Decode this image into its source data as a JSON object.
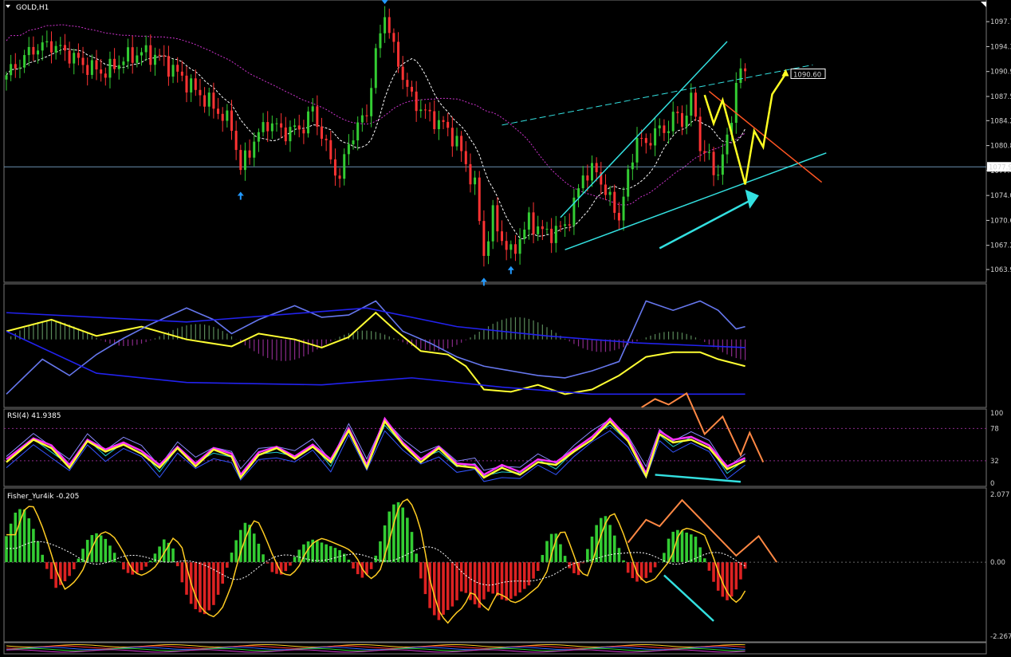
{
  "chart_data": [
    {
      "panel": "main",
      "type": "candlestick",
      "title": "GOLD,H1",
      "ylim": [
        1062.6,
        1100.0
      ],
      "yticks": [
        "1097.7",
        "1094.3",
        "1090.9",
        "1087.5",
        "1084.2",
        "1080.8",
        "1077.4",
        "1074.0",
        "1070.6",
        "1067.2",
        "1063.9"
      ],
      "current_price": "1077.9",
      "price_label": "1090.60",
      "colors": {
        "bull": "#33cc33",
        "bear": "#ff3333",
        "ma_fast": "#ffffff",
        "ma_slow": "#cc33cc",
        "channel": "#33e0e0",
        "projection": "#ffff22",
        "downtrend": "#ff5522",
        "fractal": "#2299ff"
      },
      "close_points": [
        [
          0,
          1090.4
        ],
        [
          6,
          1094.0
        ],
        [
          10,
          1094.6
        ],
        [
          14,
          1093.2
        ],
        [
          18,
          1091.5
        ],
        [
          22,
          1090.8
        ],
        [
          26,
          1092.6
        ],
        [
          30,
          1093.5
        ],
        [
          34,
          1092.8
        ],
        [
          38,
          1090.6
        ],
        [
          42,
          1088.3
        ],
        [
          46,
          1086.1
        ],
        [
          50,
          1083.5
        ],
        [
          52,
          1077.6
        ],
        [
          55,
          1081.5
        ],
        [
          58,
          1084.0
        ],
        [
          62,
          1082.6
        ],
        [
          66,
          1083.4
        ],
        [
          68,
          1085.8
        ],
        [
          70,
          1082.2
        ],
        [
          72,
          1078.9
        ],
        [
          74,
          1076.2
        ],
        [
          76,
          1081.3
        ],
        [
          80,
          1085.4
        ],
        [
          82,
          1093.1
        ],
        [
          84,
          1099.0
        ],
        [
          86,
          1093.8
        ],
        [
          88,
          1090.3
        ],
        [
          90,
          1087.1
        ],
        [
          94,
          1084.7
        ],
        [
          97,
          1083.6
        ],
        [
          100,
          1081.3
        ],
        [
          104,
          1075.2
        ],
        [
          106,
          1066.0
        ],
        [
          108,
          1071.2
        ],
        [
          110,
          1068.1
        ],
        [
          112,
          1065.9
        ],
        [
          116,
          1070.5
        ],
        [
          120,
          1068.7
        ],
        [
          124,
          1069.8
        ],
        [
          126,
          1072.7
        ],
        [
          128,
          1076.9
        ],
        [
          131,
          1077.3
        ],
        [
          134,
          1073.2
        ],
        [
          136,
          1071.1
        ],
        [
          138,
          1076.5
        ],
        [
          140,
          1082.2
        ],
        [
          142,
          1080.5
        ],
        [
          144,
          1083.2
        ],
        [
          146,
          1082.4
        ],
        [
          148,
          1085.1
        ],
        [
          150,
          1083.8
        ],
        [
          152,
          1087.4
        ],
        [
          154,
          1080.9
        ],
        [
          156,
          1079.2
        ],
        [
          157,
          1076.5
        ],
        [
          159,
          1079.3
        ],
        [
          161,
          1084.0
        ],
        [
          162,
          1090.4
        ],
        [
          164,
          1090.6
        ]
      ],
      "fractal_up_x": [
        52,
        106,
        112
      ],
      "fractal_down_x": [
        84
      ]
    },
    {
      "panel": "indicator1",
      "type": "line",
      "ylim": [
        0,
        100
      ],
      "series": [
        {
          "color": "#ffff33",
          "values": [
            [
              0,
              62
            ],
            [
              10,
              72
            ],
            [
              20,
              58
            ],
            [
              30,
              66
            ],
            [
              40,
              55
            ],
            [
              50,
              49
            ],
            [
              56,
              60
            ],
            [
              64,
              55
            ],
            [
              70,
              48
            ],
            [
              76,
              57
            ],
            [
              82,
              78
            ],
            [
              86,
              64
            ],
            [
              92,
              45
            ],
            [
              98,
              42
            ],
            [
              102,
              32
            ],
            [
              106,
              12
            ],
            [
              112,
              10
            ],
            [
              118,
              16
            ],
            [
              124,
              8
            ],
            [
              130,
              12
            ],
            [
              136,
              24
            ],
            [
              142,
              40
            ],
            [
              148,
              44
            ],
            [
              154,
              44
            ],
            [
              158,
              38
            ],
            [
              164,
              32
            ]
          ]
        },
        {
          "color": "#6677ee",
          "values": [
            [
              0,
              8
            ],
            [
              8,
              38
            ],
            [
              14,
              24
            ],
            [
              20,
              42
            ],
            [
              26,
              56
            ],
            [
              32,
              68
            ],
            [
              40,
              82
            ],
            [
              46,
              72
            ],
            [
              50,
              60
            ],
            [
              56,
              72
            ],
            [
              64,
              84
            ],
            [
              70,
              74
            ],
            [
              76,
              76
            ],
            [
              82,
              88
            ],
            [
              88,
              62
            ],
            [
              94,
              52
            ],
            [
              100,
              40
            ],
            [
              106,
              32
            ],
            [
              112,
              28
            ],
            [
              118,
              24
            ],
            [
              124,
              22
            ],
            [
              130,
              28
            ],
            [
              136,
              36
            ],
            [
              142,
              88
            ],
            [
              148,
              80
            ],
            [
              154,
              88
            ],
            [
              158,
              80
            ],
            [
              162,
              64
            ],
            [
              164,
              66
            ]
          ]
        },
        {
          "color": "#2222ee",
          "values": [
            [
              0,
              78
            ],
            [
              40,
              70
            ],
            [
              80,
              82
            ],
            [
              100,
              66
            ],
            [
              120,
              58
            ],
            [
              140,
              52
            ],
            [
              164,
              48
            ]
          ]
        },
        {
          "color": "#2222ee",
          "values": [
            [
              0,
              62
            ],
            [
              20,
              26
            ],
            [
              40,
              18
            ],
            [
              70,
              16
            ],
            [
              90,
              22
            ],
            [
              110,
              14
            ],
            [
              130,
              8
            ],
            [
              150,
              8
            ],
            [
              164,
              8
            ]
          ]
        }
      ]
    },
    {
      "panel": "indicator2",
      "type": "line",
      "title": "RSI(4) 41.9385",
      "ylim": [
        0,
        100
      ],
      "yticks": [
        "100",
        "78",
        "32",
        "0"
      ],
      "series": [
        {
          "color": "#ffff33",
          "values": [
            [
              0,
              30
            ],
            [
              6,
              62
            ],
            [
              10,
              50
            ],
            [
              14,
              22
            ],
            [
              18,
              60
            ],
            [
              22,
              45
            ],
            [
              26,
              55
            ],
            [
              30,
              42
            ],
            [
              34,
              22
            ],
            [
              38,
              50
            ],
            [
              42,
              24
            ],
            [
              46,
              48
            ],
            [
              50,
              38
            ],
            [
              52,
              8
            ],
            [
              56,
              40
            ],
            [
              60,
              50
            ],
            [
              64,
              35
            ],
            [
              68,
              52
            ],
            [
              72,
              30
            ],
            [
              76,
              75
            ],
            [
              80,
              22
            ],
            [
              84,
              88
            ],
            [
              88,
              55
            ],
            [
              92,
              30
            ],
            [
              96,
              50
            ],
            [
              100,
              25
            ],
            [
              104,
              22
            ],
            [
              106,
              8
            ],
            [
              110,
              22
            ],
            [
              114,
              12
            ],
            [
              118,
              30
            ],
            [
              122,
              26
            ],
            [
              126,
              45
            ],
            [
              130,
              62
            ],
            [
              134,
              88
            ],
            [
              138,
              60
            ],
            [
              142,
              10
            ],
            [
              145,
              70
            ],
            [
              148,
              58
            ],
            [
              152,
              62
            ],
            [
              156,
              50
            ],
            [
              160,
              20
            ],
            [
              164,
              32
            ]
          ]
        },
        {
          "color": "#ff33ff",
          "values": [
            [
              0,
              34
            ],
            [
              6,
              64
            ],
            [
              10,
              54
            ],
            [
              14,
              26
            ],
            [
              18,
              62
            ],
            [
              22,
              48
            ],
            [
              26,
              58
            ],
            [
              30,
              46
            ],
            [
              34,
              26
            ],
            [
              38,
              52
            ],
            [
              42,
              28
            ],
            [
              46,
              50
            ],
            [
              50,
              42
            ],
            [
              52,
              12
            ],
            [
              56,
              44
            ],
            [
              60,
              52
            ],
            [
              64,
              38
            ],
            [
              68,
              55
            ],
            [
              72,
              34
            ],
            [
              76,
              78
            ],
            [
              80,
              26
            ],
            [
              84,
              92
            ],
            [
              88,
              58
            ],
            [
              92,
              34
            ],
            [
              96,
              52
            ],
            [
              100,
              28
            ],
            [
              104,
              26
            ],
            [
              106,
              12
            ],
            [
              110,
              26
            ],
            [
              114,
              16
            ],
            [
              118,
              34
            ],
            [
              122,
              30
            ],
            [
              126,
              48
            ],
            [
              130,
              66
            ],
            [
              134,
              92
            ],
            [
              138,
              64
            ],
            [
              142,
              14
            ],
            [
              145,
              74
            ],
            [
              148,
              62
            ],
            [
              152,
              66
            ],
            [
              156,
              54
            ],
            [
              160,
              24
            ],
            [
              164,
              36
            ]
          ]
        }
      ]
    },
    {
      "panel": "indicator3",
      "type": "bar",
      "title": "Fisher_Yur4ik -0.205",
      "ylim": [
        -2.267,
        2.077
      ],
      "yticks": [
        "2.077",
        "0.00",
        "-2.267"
      ],
      "values": [
        0.8,
        1.5,
        1.7,
        1.2,
        0.5,
        -0.3,
        -0.8,
        -0.6,
        -0.3,
        0.3,
        0.8,
        0.9,
        0.7,
        0.3,
        -0.2,
        -0.4,
        -0.3,
        -0.1,
        0.3,
        0.7,
        0.5,
        -0.5,
        -1.2,
        -1.5,
        -1.6,
        -1.3,
        -0.7,
        0.2,
        0.9,
        1.3,
        0.8,
        0.2,
        -0.3,
        -0.4,
        -0.2,
        0.3,
        0.6,
        0.7,
        0.6,
        0.5,
        0.4,
        0.2,
        -0.3,
        -0.5,
        -0.2,
        0.6,
        1.5,
        1.9,
        1.6,
        0.8,
        -0.6,
        -1.4,
        -1.8,
        -1.5,
        -1.3,
        -0.8,
        -1.2,
        -1.4,
        -0.9,
        -1.0,
        -1.2,
        -1.1,
        -0.9,
        -0.7,
        -0.3,
        0.6,
        1.0,
        0.4,
        -0.3,
        -0.4,
        0.4,
        1.1,
        1.5,
        1.0,
        0.3,
        -0.4,
        -0.6,
        -0.5,
        -0.2,
        0.1,
        0.9,
        1.0,
        0.9,
        0.8,
        0.2,
        -0.5,
        -1.0,
        -1.2,
        -0.8,
        -0.2
      ]
    }
  ]
}
